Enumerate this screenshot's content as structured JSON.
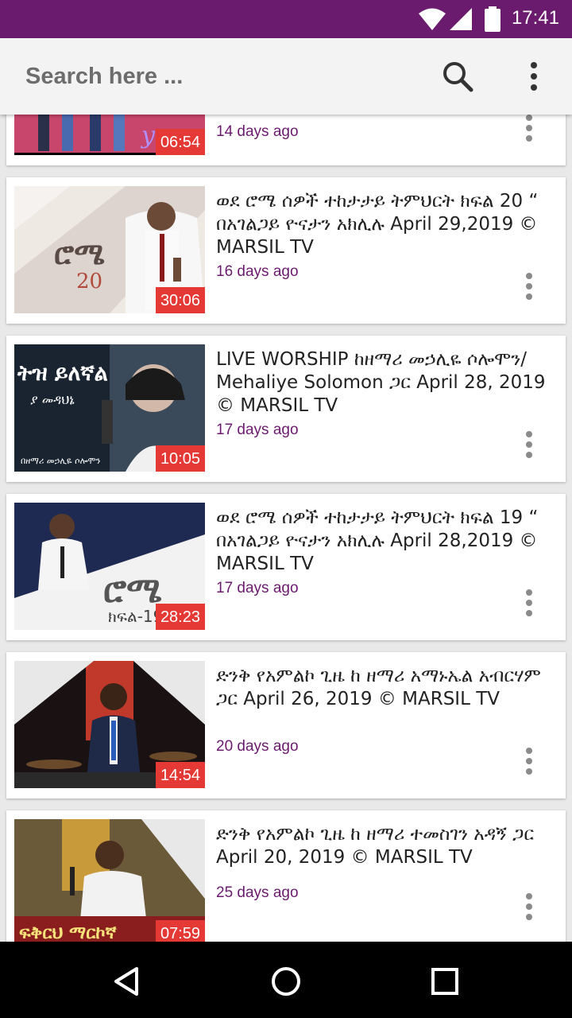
{
  "status_bar": {
    "time": "17:41",
    "icons": [
      "wifi-icon",
      "signal-icon",
      "battery-icon"
    ]
  },
  "search": {
    "placeholder": "Search here ...",
    "icons": [
      "search-icon",
      "more-vert-icon"
    ]
  },
  "colors": {
    "status_bar": "#6b1b6e",
    "accent": "#6b1b6e",
    "duration_badge": "#e53935"
  },
  "videos": [
    {
      "title": "",
      "age": "14 days ago",
      "duration": "06:54"
    },
    {
      "title": "ወደ ሮሜ ሰዎች ተከታታይ ትምህርት ክፍል 20 “ በአገልጋይ ዮናታን አክሊሉ April 29,2019 © MARSIL TV",
      "age": "16 days ago",
      "duration": "30:06",
      "thumb_text": [
        "ሮሜ",
        "20"
      ]
    },
    {
      "title": "LIVE WORSHIP ከዘማሪ መኃሊዬ ሶሎሞን/ Mehaliye Solomon ጋር April 28, 2019 © MARSIL TV",
      "age": "17 days ago",
      "duration": "10:05",
      "thumb_text": [
        "ትዝ ይለኛል",
        "ያ መዳህኔ",
        "በዘማሪ መኃሊዬ ሶሎሞን"
      ]
    },
    {
      "title": "ወደ ሮሜ ሰዎች ተከታታይ ትምህርት ክፍል 19 “ በአገልጋይ ዮናታን አክሊሉ April 28,2019 © MARSIL TV",
      "age": "17 days ago",
      "duration": "28:23",
      "thumb_text": [
        "ሮሜ",
        "ክፍል-19"
      ]
    },
    {
      "title": "ድንቅ የአምልኮ ጊዜ ከ ዘማሪ አማኑኤል አብርሃም ጋር April 26, 2019 © MARSIL TV",
      "age": "20 days ago",
      "duration": "14:54"
    },
    {
      "title": "ድንቅ የአምልኮ ጊዜ ከ ዘማሪ ተመስገን አዳኝ ጋር April 20, 2019 © MARSIL TV",
      "age": "25 days ago",
      "duration": "07:59",
      "thumb_text": [
        "ፍቅርህ ማርኮኛ"
      ]
    }
  ],
  "nav_bar": {
    "icons": [
      "back-icon",
      "home-icon",
      "recents-icon"
    ]
  }
}
